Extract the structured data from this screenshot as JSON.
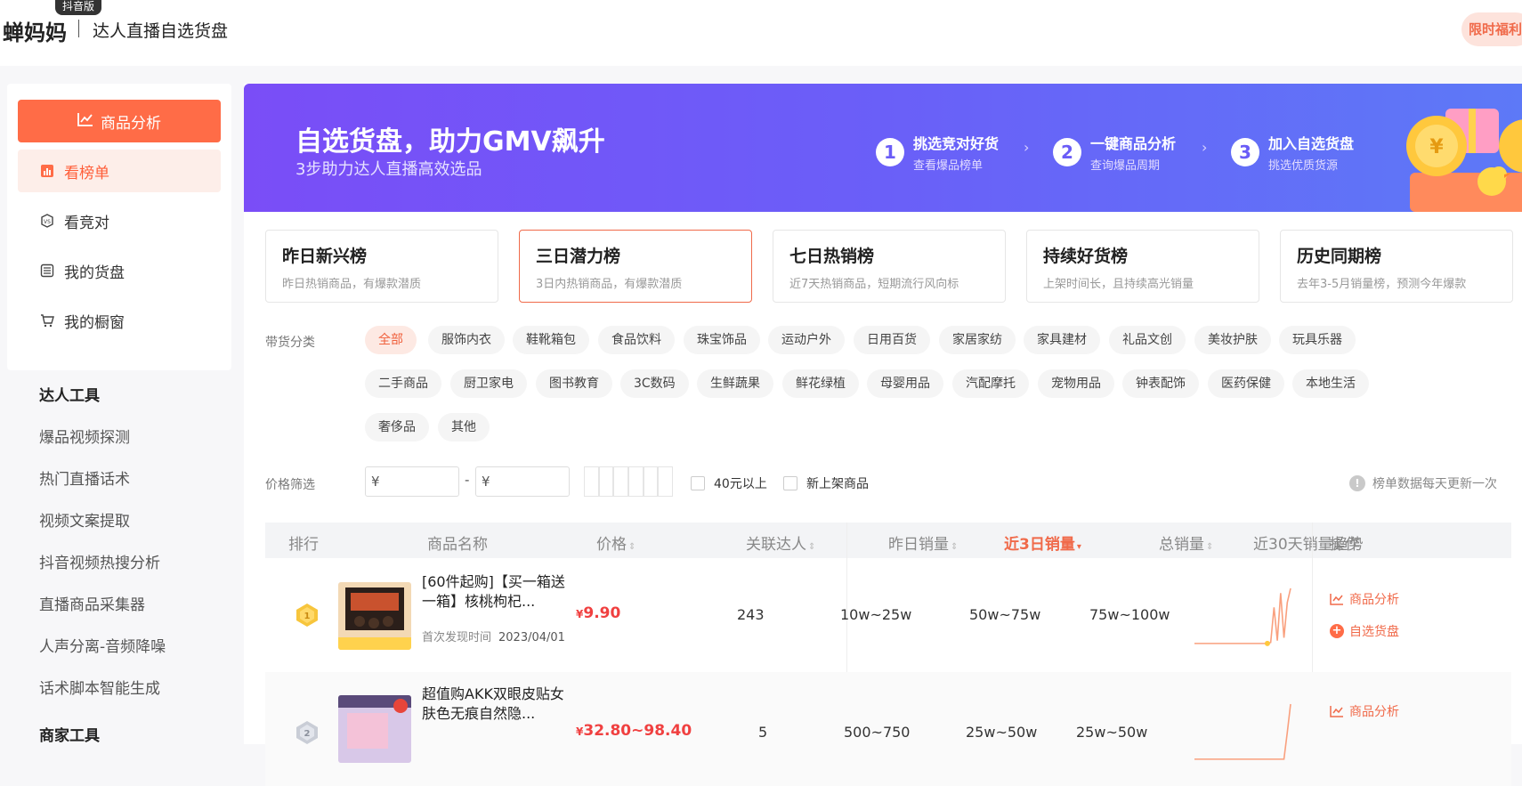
{
  "header": {
    "badge": "抖音版",
    "logo": "蝉妈妈",
    "subtitle": "达人直播自选货盘",
    "promo": "限时福利"
  },
  "sidebar": {
    "primary_button": "商品分析",
    "nav": [
      {
        "label": "看榜单",
        "icon": "bar-chart-icon",
        "active": true
      },
      {
        "label": "看竞对",
        "icon": "vs-icon",
        "active": false
      },
      {
        "label": "我的货盘",
        "icon": "list-icon",
        "active": false
      },
      {
        "label": "我的橱窗",
        "icon": "cart-icon",
        "active": false
      }
    ],
    "tools_title": "达人工具",
    "tools": [
      "爆品视频探测",
      "热门直播话术",
      "视频文案提取",
      "抖音视频热搜分析",
      "直播商品采集器",
      "人声分离-音频降噪",
      "话术脚本智能生成"
    ],
    "merchant_title": "商家工具"
  },
  "banner": {
    "title": "自选货盘，助力GMV飙升",
    "subtitle": "3步助力达人直播高效选品",
    "steps": [
      {
        "num": "1",
        "title": "挑选竞对好货",
        "desc": "查看爆品榜单"
      },
      {
        "num": "2",
        "title": "一键商品分析",
        "desc": "查询爆品周期"
      },
      {
        "num": "3",
        "title": "加入自选货盘",
        "desc": "挑选优质货源"
      }
    ]
  },
  "rank_tabs": [
    {
      "title": "昨日新兴榜",
      "desc": "昨日热销商品，有爆款潜质",
      "active": false
    },
    {
      "title": "三日潜力榜",
      "desc": "3日内热销商品，有爆款潜质",
      "active": true
    },
    {
      "title": "七日热销榜",
      "desc": "近7天热销商品，短期流行风向标",
      "active": false
    },
    {
      "title": "持续好货榜",
      "desc": "上架时间长，且持续高光销量",
      "active": false
    },
    {
      "title": "历史同期榜",
      "desc": "去年3-5月销量榜，预测今年爆款",
      "active": false
    }
  ],
  "filters": {
    "category_label": "带货分类",
    "categories": [
      "全部",
      "服饰内衣",
      "鞋靴箱包",
      "食品饮料",
      "珠宝饰品",
      "运动户外",
      "日用百货",
      "家居家纺",
      "家具建材",
      "礼品文创",
      "美妆护肤",
      "玩具乐器",
      "二手商品",
      "厨卫家电",
      "图书教育",
      "3C数码",
      "生鲜蔬果",
      "鲜花绿植",
      "母婴用品",
      "汽配摩托",
      "宠物用品",
      "钟表配饰",
      "医药保健",
      "本地生活",
      "奢侈品",
      "其他"
    ],
    "active_category": "全部",
    "price_label": "价格筛选",
    "price_min_placeholder": "¥",
    "price_max_placeholder": "¥",
    "price_dash": "-",
    "check_40": "40元以上",
    "check_new": "新上架商品",
    "update_note": "榜单数据每天更新一次"
  },
  "table": {
    "headers": {
      "rank": "排行",
      "name": "商品名称",
      "price": "价格",
      "kol": "关联达人",
      "yesterday": "昨日销量",
      "three_day": "近3日销量",
      "total": "总销量",
      "trend": "近30天销量趋势",
      "ops": "操作"
    },
    "rows": [
      {
        "rank": "1",
        "name": "[60件起购]【买一箱送一箱】核桃枸杞...",
        "first_seen_label": "首次发现时间",
        "first_seen": "2023/04/01",
        "price": "9.90",
        "kol": "243",
        "yesterday": "10w~25w",
        "three_day": "50w~75w",
        "total": "75w~100w",
        "trend": [
          2,
          2,
          2,
          2,
          2,
          2,
          2,
          2,
          2,
          2,
          2,
          2,
          2,
          2,
          2,
          2,
          2,
          2,
          2,
          2,
          2,
          2,
          2,
          3,
          40,
          5,
          55,
          8,
          45,
          60
        ]
      },
      {
        "rank": "2",
        "name": "超值购AKK双眼皮贴女肤色无痕自然隐...",
        "price": "32.80~98.40",
        "kol": "5",
        "yesterday": "500~750",
        "three_day": "25w~50w",
        "total": "25w~50w",
        "trend": [
          2,
          2,
          2,
          2,
          2,
          2,
          2,
          2,
          2,
          2,
          2,
          2,
          2,
          2,
          2,
          2,
          2,
          2,
          2,
          2,
          2,
          2,
          2,
          2,
          2,
          2,
          2,
          2,
          30,
          60
        ]
      }
    ],
    "op_analysis": "商品分析",
    "op_add": "自选货盘",
    "currency": "¥"
  }
}
